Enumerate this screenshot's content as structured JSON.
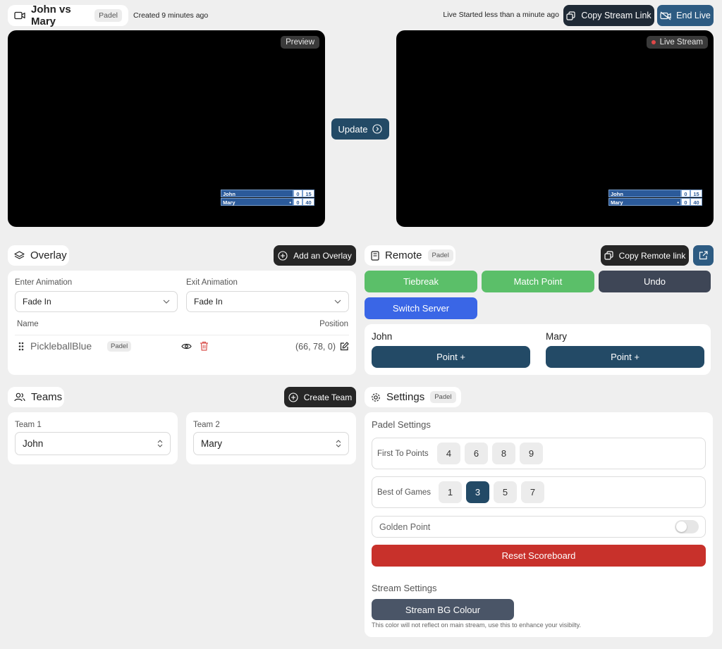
{
  "header": {
    "title": "John vs Mary",
    "sport_badge": "Padel",
    "created": "Created 9 minutes ago",
    "live_status": "Live Started less than a minute ago",
    "copy_stream_link": "Copy Stream Link",
    "end_live": "End Live"
  },
  "preview": {
    "label": "Preview",
    "live_label": "Live Stream",
    "update_button": "Update",
    "scoreboard": {
      "players": [
        {
          "name": "John",
          "serve": "",
          "games": "0",
          "points": "15"
        },
        {
          "name": "Mary",
          "serve": "•",
          "games": "0",
          "points": "40"
        }
      ]
    }
  },
  "overlay": {
    "title": "Overlay",
    "add_button": "Add an Overlay",
    "enter_label": "Enter Animation",
    "enter_value": "Fade In",
    "exit_label": "Exit Animation",
    "exit_value": "Fade In",
    "col_name": "Name",
    "col_position": "Position",
    "items": [
      {
        "name": "PickleballBlue",
        "badge": "Padel",
        "position": "(66, 78, 0)"
      }
    ]
  },
  "teams": {
    "title": "Teams",
    "create_button": "Create Team",
    "team1_label": "Team 1",
    "team1_value": "John",
    "team2_label": "Team 2",
    "team2_value": "Mary"
  },
  "remote": {
    "title": "Remote",
    "badge": "Padel",
    "copy_link": "Copy Remote link",
    "tiebreak": "Tiebreak",
    "match_point": "Match Point",
    "undo": "Undo",
    "switch_server": "Switch Server",
    "player1": "John",
    "player2": "Mary",
    "point_label": "Point +"
  },
  "settings": {
    "title": "Settings",
    "badge": "Padel",
    "padel_settings": "Padel Settings",
    "first_to_label": "First To Points",
    "first_to_options": [
      "4",
      "6",
      "8",
      "9"
    ],
    "best_of_label": "Best of Games",
    "best_of_options": [
      "1",
      "3",
      "5",
      "7"
    ],
    "best_of_selected": "3",
    "golden_point": "Golden Point",
    "golden_point_on": false,
    "reset": "Reset Scoreboard",
    "stream_settings": "Stream Settings",
    "bg_colour": "Stream BG Colour",
    "bg_note": "This color will not reflect on main stream, use this to enhance your visibilty."
  }
}
